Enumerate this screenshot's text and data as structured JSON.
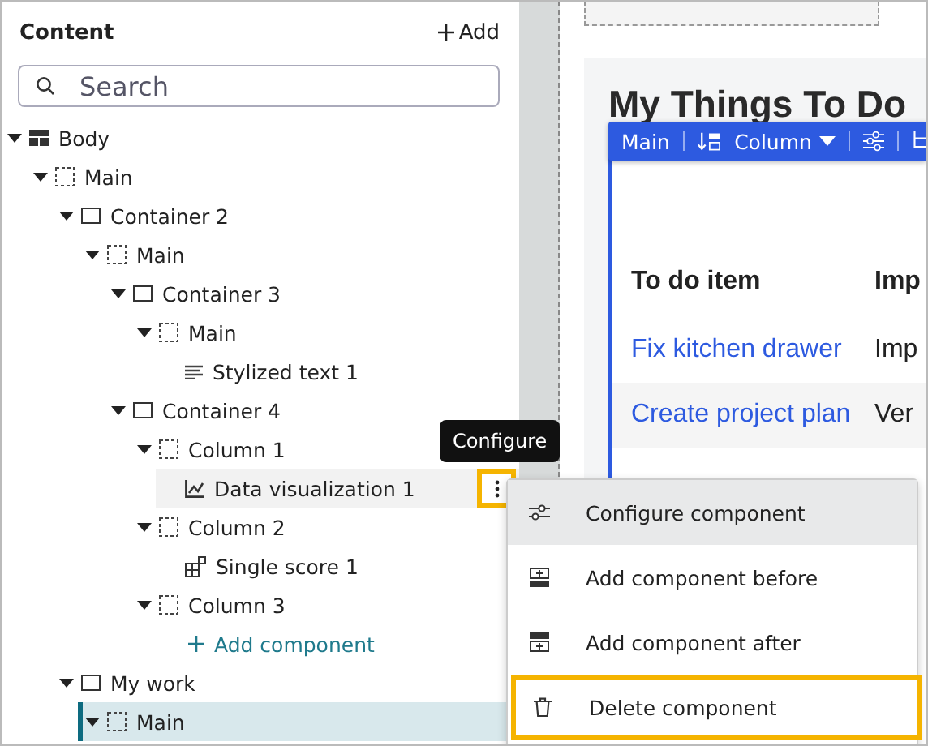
{
  "panel": {
    "title": "Content",
    "add_button": "Add",
    "search": {
      "placeholder": "Search"
    },
    "tree": [
      {
        "label": "Body",
        "kind": "layout",
        "expanded": true,
        "selected": false,
        "hovered": false,
        "children": [
          {
            "label": "Main",
            "kind": "region",
            "expanded": true,
            "selected": false,
            "hovered": false,
            "children": [
              {
                "label": "Container 2",
                "kind": "container",
                "expanded": true,
                "selected": false,
                "hovered": false,
                "children": [
                  {
                    "label": "Main",
                    "kind": "region",
                    "expanded": true,
                    "selected": false,
                    "hovered": false,
                    "children": [
                      {
                        "label": "Container 3",
                        "kind": "container",
                        "expanded": true,
                        "selected": false,
                        "hovered": false,
                        "children": [
                          {
                            "label": "Main",
                            "kind": "region",
                            "expanded": true,
                            "selected": false,
                            "hovered": false,
                            "children": [
                              {
                                "label": "Stylized text 1",
                                "kind": "text",
                                "selected": false,
                                "hovered": false
                              }
                            ]
                          }
                        ]
                      },
                      {
                        "label": "Container 4",
                        "kind": "container",
                        "expanded": true,
                        "selected": false,
                        "hovered": false,
                        "children": [
                          {
                            "label": "Column 1",
                            "kind": "region",
                            "expanded": true,
                            "selected": false,
                            "hovered": false,
                            "children": [
                              {
                                "label": "Data visualization 1",
                                "kind": "chart",
                                "selected": false,
                                "hovered": true
                              }
                            ]
                          },
                          {
                            "label": "Column 2",
                            "kind": "region",
                            "expanded": true,
                            "selected": false,
                            "hovered": false,
                            "children": [
                              {
                                "label": "Single score 1",
                                "kind": "score",
                                "selected": false,
                                "hovered": false
                              }
                            ]
                          },
                          {
                            "label": "Column 3",
                            "kind": "region",
                            "expanded": true,
                            "selected": false,
                            "hovered": false,
                            "children": [
                              {
                                "label": "Add component",
                                "kind": "add",
                                "selected": false,
                                "hovered": false
                              }
                            ]
                          }
                        ]
                      }
                    ]
                  }
                ]
              },
              {
                "label": "My work",
                "kind": "container",
                "expanded": true,
                "selected": false,
                "hovered": false,
                "children": [
                  {
                    "label": "Main",
                    "kind": "region",
                    "expanded": true,
                    "selected": true,
                    "hovered": false
                  }
                ]
              }
            ]
          }
        ]
      }
    ]
  },
  "tooltip": "Configure",
  "context_menu": [
    {
      "label": "Configure component",
      "kind": "configure",
      "hovered": true,
      "focused": false
    },
    {
      "label": "Add component before",
      "kind": "before",
      "hovered": false,
      "focused": false
    },
    {
      "label": "Add component after",
      "kind": "after",
      "hovered": false,
      "focused": false
    },
    {
      "label": "Delete component",
      "kind": "delete",
      "hovered": false,
      "focused": true
    }
  ],
  "canvas": {
    "heading": "My Things To Do",
    "toolbar": {
      "region": "Main",
      "layout": "Column"
    },
    "table": {
      "columns": [
        "To do item",
        "Imp"
      ],
      "rows": [
        [
          "Fix kitchen drawer",
          "Imp"
        ],
        [
          "Create project plan",
          "Ver"
        ]
      ]
    }
  }
}
